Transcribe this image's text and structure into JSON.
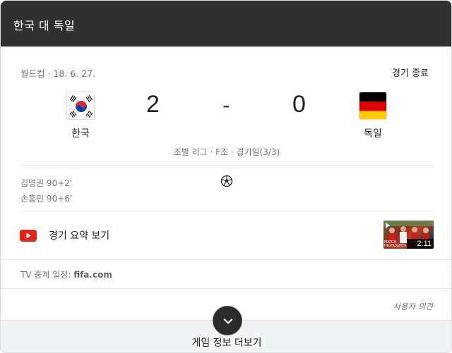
{
  "header": {
    "title": "한국 대 독일"
  },
  "match": {
    "competition_date": "월드컵 · 18. 6. 27.",
    "status": "경기 종료",
    "home": {
      "name": "한국",
      "score": "2",
      "flag_icon": "south-korea-flag-icon"
    },
    "away": {
      "name": "독일",
      "score": "0",
      "flag_icon": "germany-flag-icon"
    },
    "separator": "-",
    "info": "조별 리그 · F조 · 경기일(3/3)"
  },
  "scorers": [
    {
      "text": "김영권 90+2'"
    },
    {
      "text": "손흥민 90+6'"
    }
  ],
  "highlights": {
    "label": "경기 요약 보기",
    "duration": "2:11",
    "thumb_caption": "MATCH HIGHLIGHTS"
  },
  "tv": {
    "prefix": "TV 중계 일정: ",
    "source": "fifa.com"
  },
  "feedback": "사용자 의견",
  "more": {
    "label": "게임 정보 더보기"
  },
  "colors": {
    "header_bg": "#303030",
    "youtube_red": "#ff0000",
    "muted_text": "#70757a"
  }
}
